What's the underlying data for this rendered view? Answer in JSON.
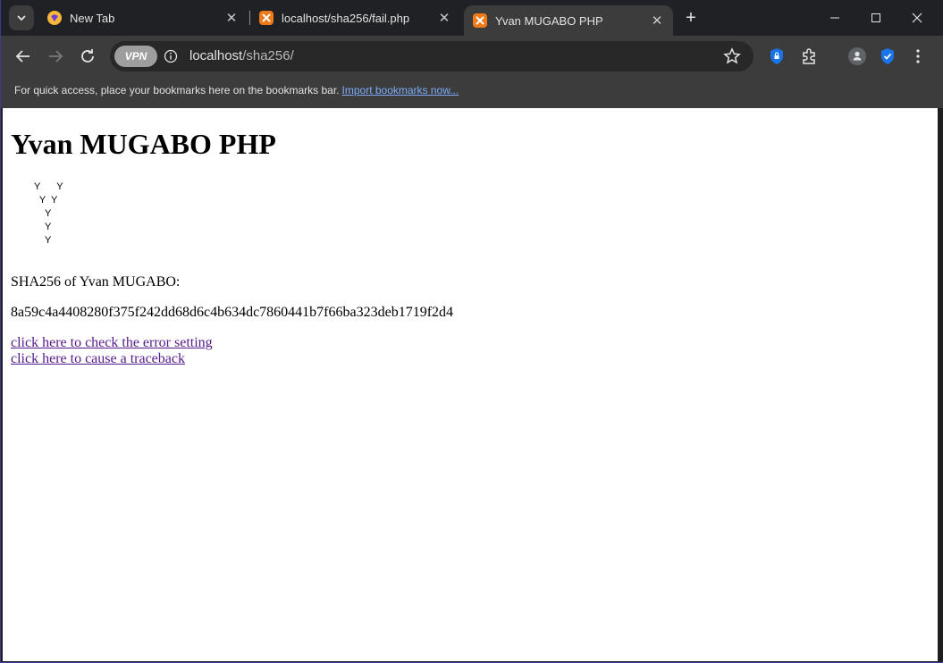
{
  "browser": {
    "tabs": [
      {
        "title": "New Tab",
        "active": false
      },
      {
        "title": "localhost/sha256/fail.php",
        "active": false
      },
      {
        "title": "Yvan MUGABO PHP",
        "active": true
      }
    ],
    "address": {
      "host": "localhost",
      "path": "/sha256/"
    },
    "vpn_label": "VPN",
    "bookmarks_bar": {
      "message": "For quick access, place your bookmarks here on the bookmarks bar.",
      "import_link": "Import bookmarks now..."
    },
    "colors": {
      "link": "#551a8b",
      "bookmark_link": "#7cacf8",
      "tab_bg": "#3c3c3c",
      "strip_bg": "#202124"
    }
  },
  "page": {
    "heading": "Yvan MUGABO PHP",
    "ascii_art": [
      "Y      Y",
      "  Y  Y",
      "    Y",
      "    Y",
      "    Y"
    ],
    "sha_label": "SHA256 of Yvan MUGABO:",
    "sha_value": "8a59c4a4408280f375f242dd68d6c4b634dc7860441b7f66ba323deb1719f2d4",
    "links": [
      {
        "text": "click here to check the error setting"
      },
      {
        "text": "click here to cause a traceback"
      }
    ]
  }
}
